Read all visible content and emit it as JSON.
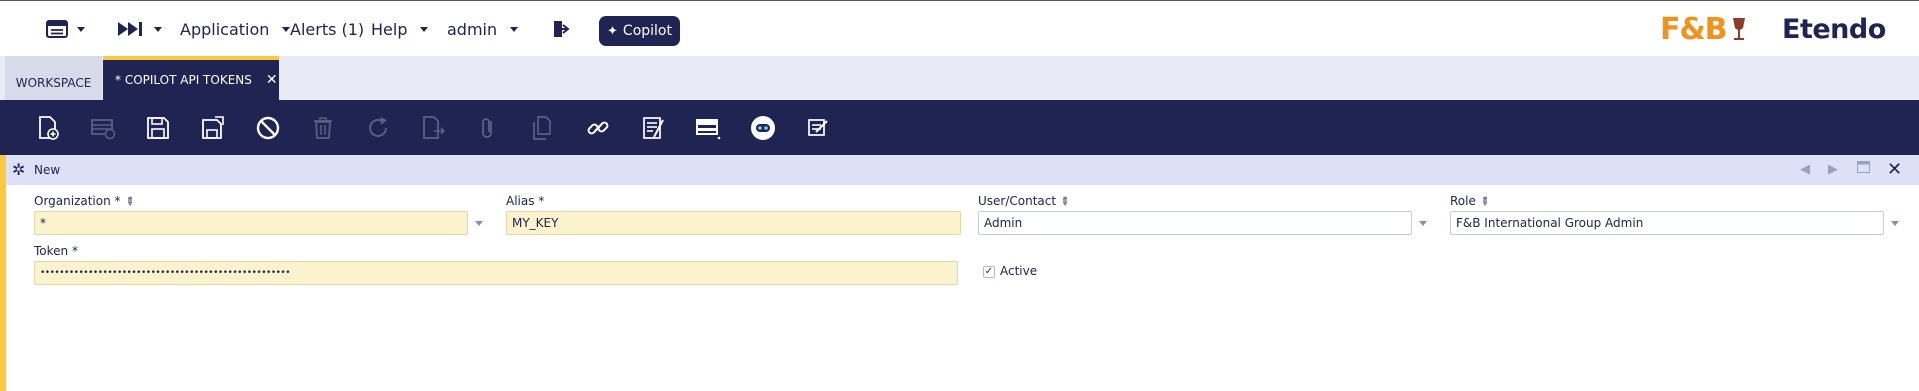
{
  "topbar": {
    "menu_items": {
      "application": "Application",
      "alerts": "Alerts (1)",
      "help": "Help",
      "user": "admin"
    },
    "copilot_label": "Copilot",
    "logos": {
      "fb": "F&B",
      "etendo": "Etendo"
    }
  },
  "tabs": {
    "workspace": "WORKSPACE",
    "active": "* COPILOT API TOKENS",
    "close": "✕"
  },
  "toolbar": {
    "buttons": [
      {
        "name": "new-document-icon",
        "enabled": true
      },
      {
        "name": "new-row-icon",
        "enabled": false
      },
      {
        "name": "save-icon",
        "enabled": true
      },
      {
        "name": "save-and-close-icon",
        "enabled": true
      },
      {
        "name": "undo-cancel-icon",
        "enabled": true
      },
      {
        "name": "delete-icon",
        "enabled": false
      },
      {
        "name": "refresh-icon",
        "enabled": false
      },
      {
        "name": "export-icon",
        "enabled": false
      },
      {
        "name": "attachment-icon",
        "enabled": false
      },
      {
        "name": "clone-icon",
        "enabled": false
      },
      {
        "name": "link-icon",
        "enabled": true
      },
      {
        "name": "audit-icon",
        "enabled": true
      },
      {
        "name": "grid-view-icon",
        "enabled": true
      },
      {
        "name": "copilot-robot-icon",
        "enabled": true
      },
      {
        "name": "notes-icon",
        "enabled": true
      }
    ]
  },
  "form": {
    "status": "New",
    "fields": {
      "organization": {
        "label": "Organization *",
        "value": "*"
      },
      "alias": {
        "label": "Alias *",
        "value": "MY_KEY"
      },
      "user_contact": {
        "label": "User/Contact",
        "value": "Admin"
      },
      "role": {
        "label": "Role",
        "value": "F&B International Group Admin"
      },
      "token": {
        "label": "Token *",
        "value": "••••••••••••••••••••••••••••••••••••••••••••••••••••"
      },
      "active": {
        "label": "Active",
        "checked": true
      }
    }
  },
  "colors": {
    "navy": "#202452",
    "accent_yellow": "#fbc93d",
    "required_field": "#fbf3cd",
    "brand_orange": "#f2921d"
  }
}
